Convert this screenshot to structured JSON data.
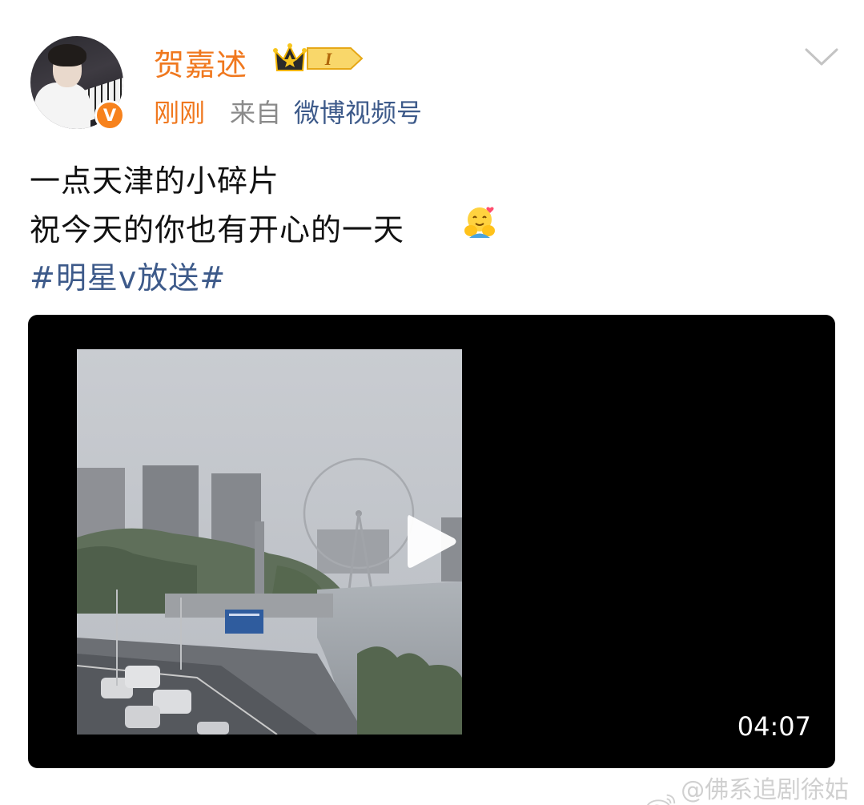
{
  "post": {
    "author": {
      "name": "贺嘉述",
      "verified_mark": "V",
      "vip_level": "I"
    },
    "meta": {
      "time": "刚刚",
      "source_prefix": "来自",
      "source_name": "微博视频号"
    },
    "text_lines": [
      "一点天津的小碎片",
      "祝今天的你也有开心的一天"
    ],
    "hashtag": "#明星v放送#",
    "video": {
      "duration": "04:07"
    }
  },
  "watermark": {
    "text": "@佛系追剧徐姑姑"
  },
  "colors": {
    "name_orange": "#f0781e",
    "link_blue": "#3d5a8a",
    "video_bg": "#000000"
  }
}
